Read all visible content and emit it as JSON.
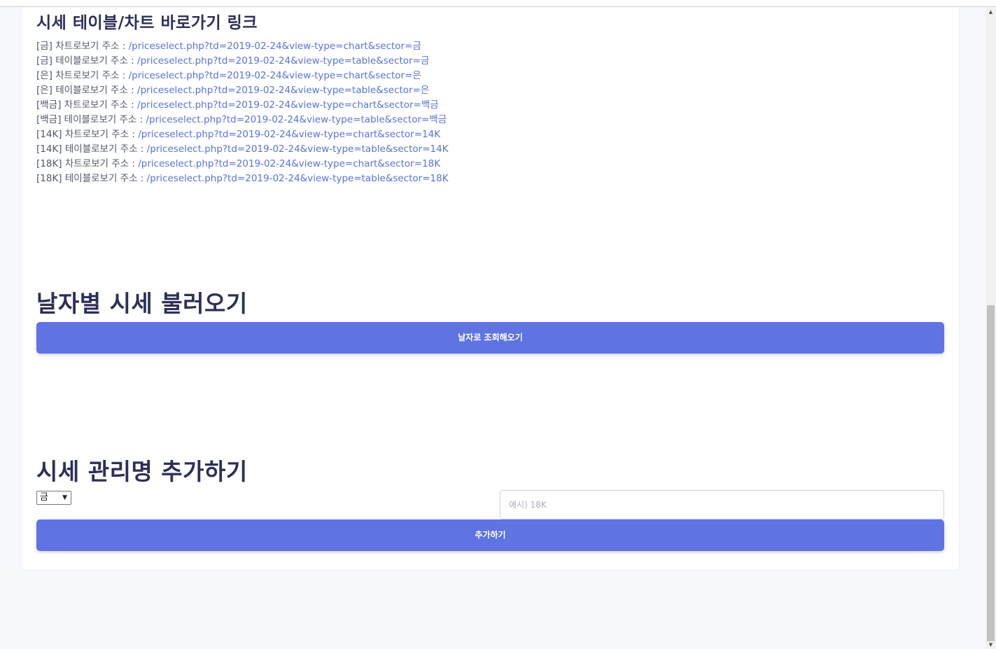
{
  "links_section": {
    "title": "시세 테이블/차트 바로가기 링크",
    "items": [
      {
        "label": "[금] 차트로보기 주소 : ",
        "url": "/priceselect.php?td=2019-02-24&view-type=chart&sector=금"
      },
      {
        "label": "[금] 테이블로보기 주소 : ",
        "url": "/priceselect.php?td=2019-02-24&view-type=table&sector=금"
      },
      {
        "label": "[은] 차트로보기 주소 : ",
        "url": "/priceselect.php?td=2019-02-24&view-type=chart&sector=은"
      },
      {
        "label": "[은] 테이블로보기 주소 : ",
        "url": "/priceselect.php?td=2019-02-24&view-type=table&sector=은"
      },
      {
        "label": "[백금] 차트로보기 주소 : ",
        "url": "/priceselect.php?td=2019-02-24&view-type=chart&sector=백금"
      },
      {
        "label": "[백금] 테이블로보기 주소 : ",
        "url": "/priceselect.php?td=2019-02-24&view-type=table&sector=백금"
      },
      {
        "label": "[14K] 차트로보기 주소 : ",
        "url": "/priceselect.php?td=2019-02-24&view-type=chart&sector=14K"
      },
      {
        "label": "[14K] 테이블로보기 주소 : ",
        "url": "/priceselect.php?td=2019-02-24&view-type=table&sector=14K"
      },
      {
        "label": "[18K] 차트로보기 주소 : ",
        "url": "/priceselect.php?td=2019-02-24&view-type=chart&sector=18K"
      },
      {
        "label": "[18K] 테이블로보기 주소 : ",
        "url": "/priceselect.php?td=2019-02-24&view-type=table&sector=18K"
      }
    ]
  },
  "date_section": {
    "title": "날자별 시세 불러오기",
    "button_label": "날자로 조회해오기"
  },
  "add_section": {
    "title": "시세 관리명 추가하기",
    "select_value": "금",
    "input_value": "",
    "input_placeholder": "예시) 18K",
    "button_label": "추가하기"
  },
  "colors": {
    "accent": "#5f73e2",
    "link": "#5a72dc",
    "heading": "#2d2f58"
  }
}
